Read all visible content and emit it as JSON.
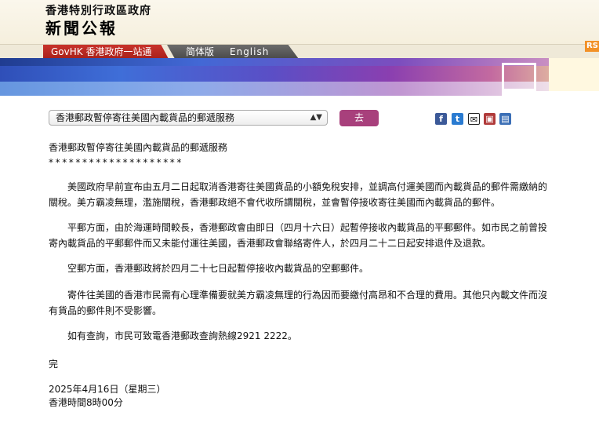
{
  "header": {
    "gov_name": "香港特別行政區政府",
    "section_title": "新聞公報"
  },
  "nav": {
    "govhk": "GovHK 香港政府一站通",
    "simplified": "简体版",
    "english": "English",
    "rss": "RS"
  },
  "selector": {
    "selected": "香港郵政暫停寄往美國內載貨品的郵遞服務",
    "go_label": "去"
  },
  "share": {
    "facebook": "f",
    "twitter": "t",
    "email": "✉",
    "print": "▣",
    "bookmark": "▤"
  },
  "article": {
    "title": "香港郵政暫停寄往美國內載貨品的郵遞服務",
    "stars": "********************",
    "paragraphs": [
      "美國政府早前宣布由五月二日起取消香港寄往美國貨品的小額免稅安排，並調高付運美國而內載貨品的郵件需繳納的關稅。美方霸凌無理，濫施關稅，香港郵政絕不會代收所謂關稅，並會暫停接收寄往美國而內載貨品的郵件。",
      "平郵方面，由於海運時間較長，香港郵政會由即日（四月十六日）起暫停接收內載貨品的平郵郵件。如市民之前曾投寄內載貨品的平郵郵件而又未能付運往美國，香港郵政會聯絡寄件人，於四月二十二日起安排退件及退款。",
      "空郵方面，香港郵政將於四月二十七日起暫停接收內載貨品的空郵郵件。",
      "寄件往美國的香港市民需有心理準備要就美方霸凌無理的行為因而要繳付高昂和不合理的費用。其他只內載文件而沒有貨品的郵件則不受影響。",
      "如有查詢，市民可致電香港郵政查詢熱線2921 2222。"
    ],
    "end_mark": "完",
    "date": "2025年4月16日（星期三）",
    "time": "香港時間8時00分"
  }
}
